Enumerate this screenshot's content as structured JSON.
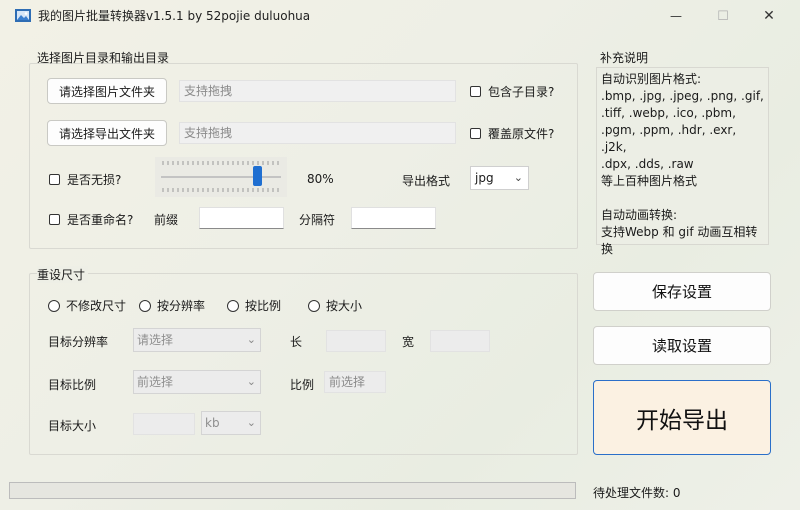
{
  "window": {
    "title": "我的图片批量转换器v1.5.1 by 52pojie duluohua",
    "minimize_glyph": "—",
    "maximize_glyph": "☐",
    "close_glyph": "✕"
  },
  "dirs": {
    "group_title": "选择图片目录和输出目录",
    "choose_image_folder_btn": "请选择图片文件夹",
    "image_folder_placeholder": "支持拖拽",
    "include_subdirs_label": "包含子目录?",
    "choose_output_folder_btn": "请选择导出文件夹",
    "output_folder_placeholder": "支持拖拽",
    "overwrite_label": "覆盖原文件?",
    "lossless_label": "是否无损?",
    "quality_value": "80%",
    "export_format_label": "导出格式",
    "export_format_value": "jpg",
    "rename_label": "是否重命名?",
    "prefix_label": "前缀",
    "separator_label": "分隔符"
  },
  "quality_slider": {
    "min": 0,
    "max": 100,
    "value": 80
  },
  "notes": {
    "title": "补充说明",
    "lines": [
      "自动识别图片格式:",
      ".bmp, .jpg, .jpeg, .png, .gif,",
      ".tiff, .webp, .ico, .pbm,",
      ".pgm, .ppm, .hdr, .exr, .j2k,",
      ".dpx, .dds, .raw",
      "等上百种图片格式",
      "",
      "自动动画转换:",
      "支持Webp 和 gif 动画互相转",
      "换"
    ]
  },
  "resize": {
    "group_title": "重设尺寸",
    "options": [
      "不修改尺寸",
      "按分辨率",
      "按比例",
      "按大小"
    ],
    "target_resolution_label": "目标分辨率",
    "target_resolution_placeholder": "请选择",
    "length_label": "长",
    "width_label": "宽",
    "target_ratio_label": "目标比例",
    "target_ratio_placeholder": "前选择",
    "ratio_label": "比例",
    "ratio_placeholder": "前选择",
    "target_size_label": "目标大小",
    "size_unit": "kb"
  },
  "actions": {
    "save_settings": "保存设置",
    "load_settings": "读取设置",
    "start_export": "开始导出"
  },
  "status": {
    "pending_files": "待处理文件数: 0",
    "progress": 0.0
  },
  "colors": {
    "accent": "#1f6fd1",
    "start_button_bg": "#fbf1e2",
    "progress_fill": "#06b025"
  }
}
